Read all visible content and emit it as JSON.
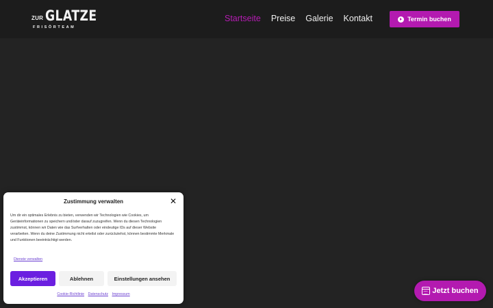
{
  "header": {
    "logo": {
      "small": "ZUR",
      "big": "GLATZE",
      "sub": "FRISÖRTEAM"
    },
    "nav": [
      {
        "label": "Startseite",
        "active": true
      },
      {
        "label": "Preise",
        "active": false
      },
      {
        "label": "Galerie",
        "active": false
      },
      {
        "label": "Kontakt",
        "active": false
      }
    ],
    "cta_label": "Termin buchen",
    "cta_icon": "play-circle-icon"
  },
  "consent": {
    "title": "Zustimmung verwalten",
    "close_icon": "close-icon",
    "text": "Um dir ein optimales Erlebnis zu bieten, verwenden wir Technologien wie Cookies, um Geräteinformationen zu speichern und/oder darauf zuzugreifen. Wenn du diesen Technologien zustimmst, können wir Daten wie das Surfverhalten oder eindeutige IDs auf dieser Website verarbeiten. Wenn du deine Zustimmung nicht erteilst oder zurückziehst, können bestimmte Merkmale und Funktionen beeinträchtigt werden.",
    "services_link": "Dienste verwalten",
    "buttons": {
      "accept": "Akzeptieren",
      "decline": "Ablehnen",
      "settings": "Einstellungen ansehen"
    },
    "links": [
      "Cookie-Richtlinie",
      "Datenschutz",
      "Impressum"
    ]
  },
  "floating": {
    "label": "Jetzt buchen",
    "icon": "calendar-icon"
  },
  "colors": {
    "accent": "#b31ab0",
    "accept": "#6b1fe0",
    "background": "#232323",
    "header": "#1c1c1c"
  }
}
